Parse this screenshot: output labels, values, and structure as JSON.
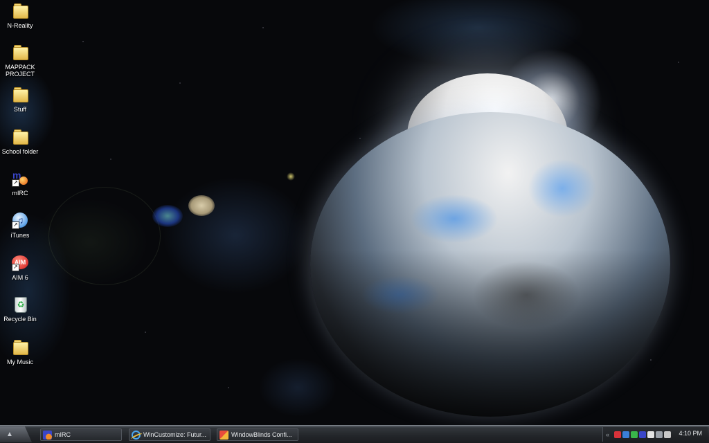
{
  "desktop": {
    "icons": [
      {
        "label": "N-Reality",
        "type": "folder"
      },
      {
        "label": "MAPPACK\nPROJECT",
        "type": "folder"
      },
      {
        "label": "Stuff",
        "type": "folder"
      },
      {
        "label": "School folder",
        "type": "folder"
      },
      {
        "label": "mIRC",
        "type": "shortcut"
      },
      {
        "label": "iTunes",
        "type": "shortcut"
      },
      {
        "label": "AIM 6",
        "type": "shortcut"
      },
      {
        "label": "Recycle Bin",
        "type": "system"
      },
      {
        "label": "My Music",
        "type": "folder"
      }
    ],
    "aim_icon_text": "AIM"
  },
  "taskbar": {
    "start_glyph": "▲",
    "buttons": [
      {
        "label": "mIRC",
        "icon": "mirc-icon"
      },
      {
        "label": "WinCustomize: Futur...",
        "icon": "internet-explorer-icon"
      },
      {
        "label": "WindowBlinds Confi...",
        "icon": "windowblinds-icon"
      }
    ],
    "tray": {
      "expand_glyph": "«",
      "clock": "4:10 PM",
      "icon_colors": [
        "#d8323a",
        "#3a7fd8",
        "#39b54a",
        "#3a46c8",
        "#e2e2e2",
        "#9aa0a8",
        "#c8c8c8"
      ]
    }
  }
}
